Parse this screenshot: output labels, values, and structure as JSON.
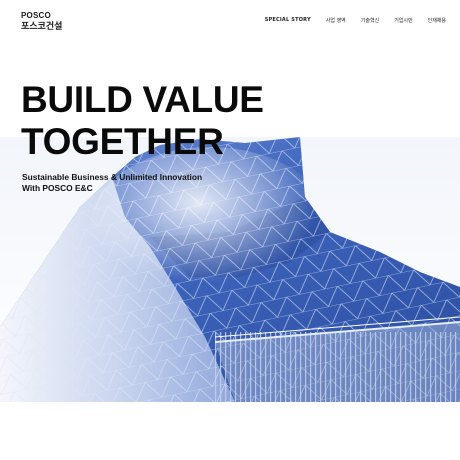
{
  "brand": {
    "name_en": "POSCO",
    "name_ko": "포스코건설"
  },
  "nav": {
    "items": [
      {
        "label": "SPECIAL STORY"
      },
      {
        "label": "사업 영역"
      },
      {
        "label": "기술혁신"
      },
      {
        "label": "기업시민"
      },
      {
        "label": "인재채용"
      }
    ]
  },
  "hero": {
    "headline_line1": "BUILD VALUE",
    "headline_line2": "TOGETHER",
    "subline_line1": "Sustainable Business & Unlimited Innovation",
    "subline_line2": "With POSCO E&C",
    "image_subject": "modern-building-facade"
  },
  "colors": {
    "accent_blue": "#3a62b5",
    "text": "#111111",
    "background": "#ffffff"
  }
}
